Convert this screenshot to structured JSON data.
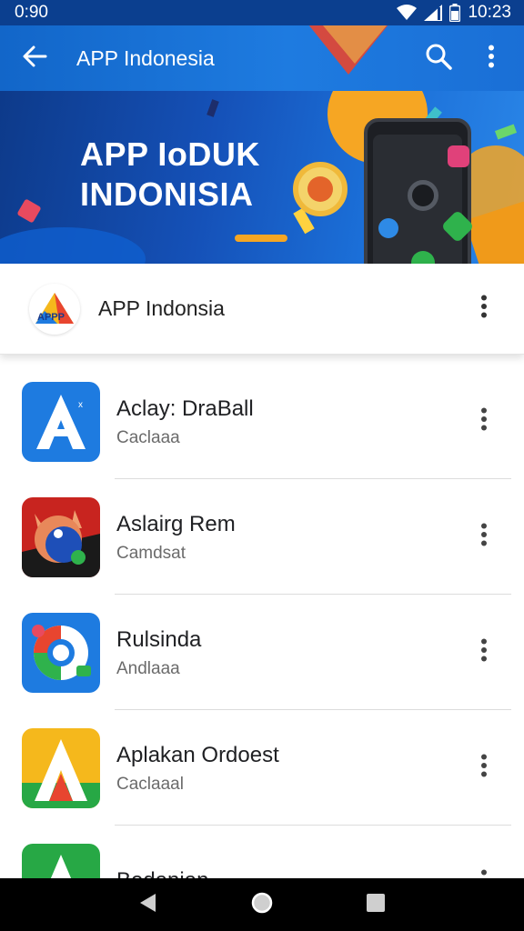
{
  "status_bar": {
    "time_left": "0:90",
    "time_right": "10:23"
  },
  "app_bar": {
    "title": "APP Indonesia",
    "back_icon": "arrow-left-icon",
    "search_icon": "search-icon",
    "more_icon": "more-vert-icon"
  },
  "banner": {
    "line1": "APP IoDUK",
    "line2": "INDONISIA"
  },
  "featured": {
    "name": "APP Indonsia",
    "logo_text": "APPP"
  },
  "apps": [
    {
      "name": "Aclay: DraBall",
      "subtitle": "Caclaaa",
      "icon": "letter-a-icon",
      "color": "#1e7be0"
    },
    {
      "name": "Aslairg Rem",
      "subtitle": "Camdsat",
      "icon": "cartoon-cat-icon",
      "color": "#d42a2a"
    },
    {
      "name": "Rulsinda",
      "subtitle": "Andlaaa",
      "icon": "camera-circle-icon",
      "color": "#1e7be0"
    },
    {
      "name": "Aplakan Ordoest",
      "subtitle": "Caclaaal",
      "icon": "letter-a-icon",
      "color": "#f5b81c"
    },
    {
      "name": "Bedanian",
      "subtitle": "",
      "icon": "letter-a-icon",
      "color": "#27a845"
    }
  ],
  "colors": {
    "app_bar": "#1a6fd6",
    "status_bar": "#0b3f8f",
    "nav_bar": "#000000"
  }
}
